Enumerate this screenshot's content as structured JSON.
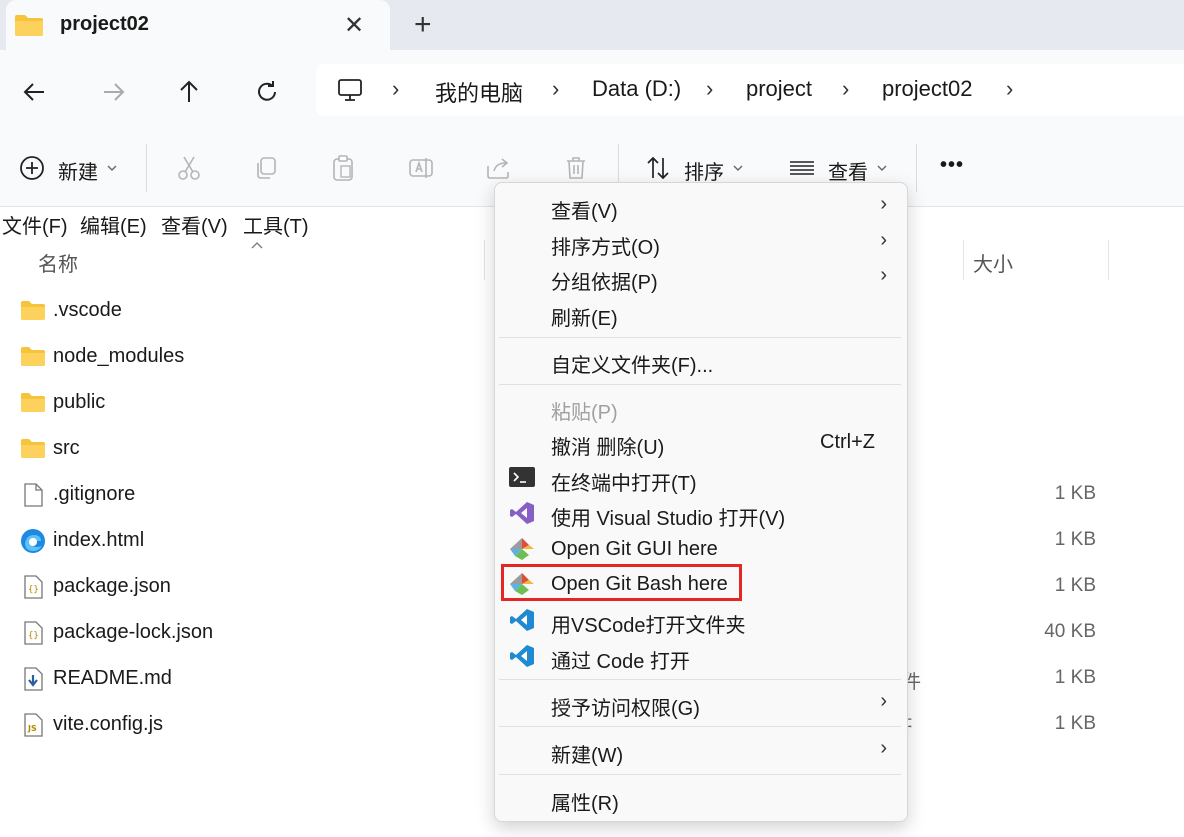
{
  "tab": {
    "title": "project02",
    "close": "✕",
    "new_tab": "+"
  },
  "nav": {
    "back": "←",
    "forward": "→",
    "up": "↑",
    "refresh": "↻",
    "breadcrumbs": [
      "我的电脑",
      "Data (D:)",
      "project",
      "project02"
    ],
    "separator": "›"
  },
  "command_bar": {
    "new_label": "新建",
    "sort_label": "排序",
    "view_label": "查看",
    "more": "•••"
  },
  "menu_bar": [
    "文件(F)",
    "编辑(E)",
    "查看(V)",
    "工具(T)"
  ],
  "columns": {
    "name": "名称",
    "size": "大小"
  },
  "files": [
    {
      "name": ".vscode",
      "icon": "folder-icon",
      "size": "",
      "type": ""
    },
    {
      "name": "node_modules",
      "icon": "folder-icon",
      "size": "",
      "type": ""
    },
    {
      "name": "public",
      "icon": "folder-icon",
      "size": "",
      "type": ""
    },
    {
      "name": "src",
      "icon": "folder-icon",
      "size": "",
      "type": ""
    },
    {
      "name": ".gitignore",
      "icon": "file-icon",
      "size": "1 KB",
      "type": ""
    },
    {
      "name": "index.html",
      "icon": "edge-html-icon",
      "size": "1 KB",
      "type": ""
    },
    {
      "name": "package.json",
      "icon": "json-file-icon",
      "size": "1 KB",
      "type": ""
    },
    {
      "name": "package-lock.json",
      "icon": "json-file-icon",
      "size": "40 KB",
      "type": ""
    },
    {
      "name": "README.md",
      "icon": "markdown-file-icon",
      "size": "1 KB",
      "type": "件"
    },
    {
      "name": "vite.config.js",
      "icon": "js-file-icon",
      "size": "1 KB",
      "type": "‡"
    }
  ],
  "context_menu": {
    "view": "查看(V)",
    "sort_by": "排序方式(O)",
    "group_by": "分组依据(P)",
    "refresh": "刷新(E)",
    "customize": "自定义文件夹(F)...",
    "paste": "粘贴(P)",
    "undo_delete": "撤消 删除(U)",
    "undo_shortcut": "Ctrl+Z",
    "open_terminal": "在终端中打开(T)",
    "open_vs": "使用 Visual Studio 打开(V)",
    "git_gui": "Open Git GUI here",
    "git_bash": "Open Git Bash here",
    "open_vscode_folder": "用VSCode打开文件夹",
    "open_code": "通过 Code 打开",
    "grant_access": "授予访问权限(G)",
    "new": "新建(W)",
    "properties": "属性(R)",
    "submenu_arrow": "›"
  },
  "colors": {
    "folder": "#f8c33c",
    "highlight_border": "#e32626",
    "vscode_blue": "#1f8ad2",
    "vs_purple": "#865fc5"
  }
}
